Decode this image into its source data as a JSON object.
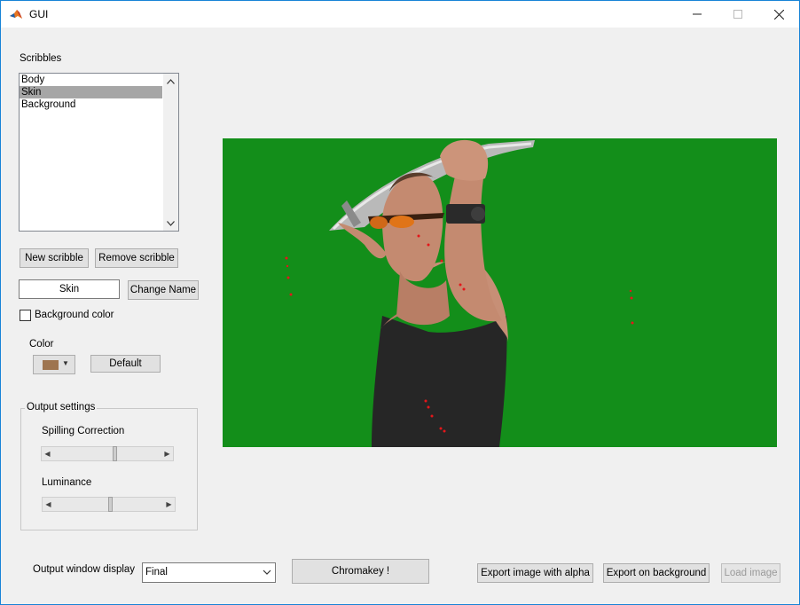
{
  "window": {
    "title": "GUI",
    "app_icon": "matlab-icon"
  },
  "scribbles": {
    "label": "Scribbles",
    "items": [
      {
        "label": "Body",
        "selected": false
      },
      {
        "label": "Skin",
        "selected": true
      },
      {
        "label": "Background",
        "selected": false
      }
    ],
    "new_button": "New scribble",
    "remove_button": "Remove scribble",
    "name_value": "Skin",
    "change_name_button": "Change Name",
    "background_color_label": "Background color",
    "background_color_checked": false,
    "color_label": "Color",
    "color_value": "#9e7550",
    "default_button": "Default"
  },
  "output_settings": {
    "title": "Output settings",
    "spilling_label": "Spilling Correction",
    "spilling_value": 0.55,
    "luminance_label": "Luminance",
    "luminance_value": 0.5
  },
  "bottom": {
    "output_label": "Output window display",
    "output_value": "Final",
    "chromakey_button": "Chromakey !",
    "export_alpha_button": "Export image with alpha",
    "export_background_button": "Export on background",
    "load_image_button": "Load image"
  },
  "image": {
    "description_icon": "chroma-preview-image",
    "background_color": "#138e1a",
    "scribble_color": "#e4161a"
  }
}
